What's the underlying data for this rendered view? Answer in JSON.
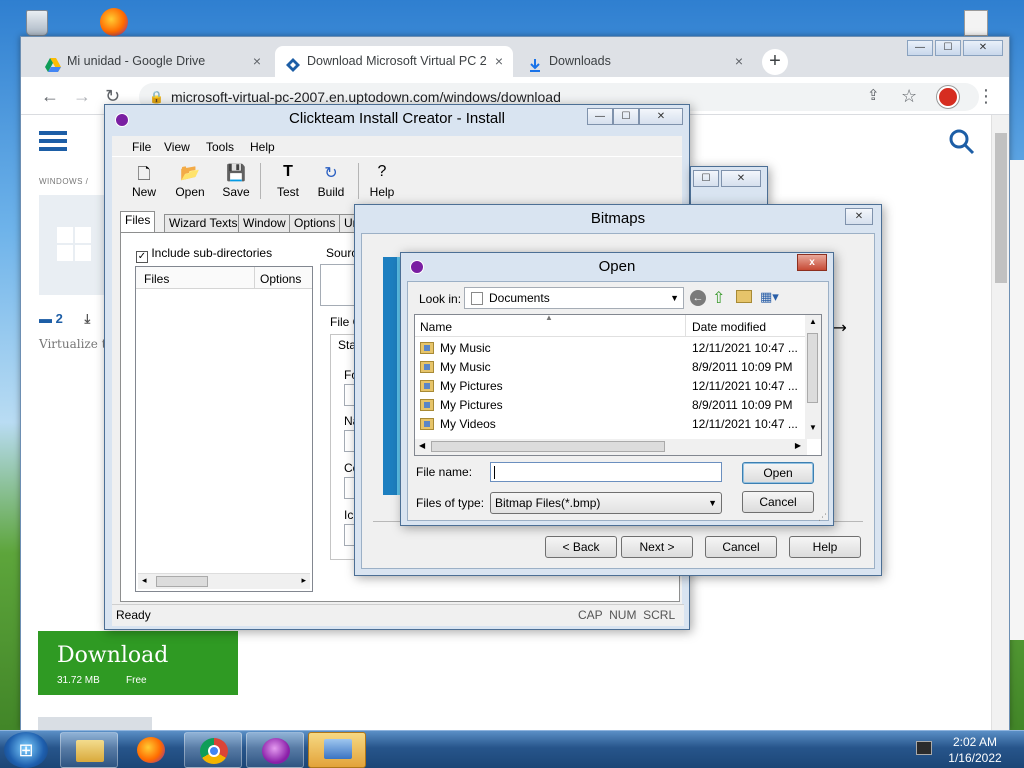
{
  "chrome": {
    "tabs": [
      {
        "label": "Mi unidad - Google Drive",
        "close": "×"
      },
      {
        "label": "Download Microsoft Virtual PC 2",
        "close": "×"
      },
      {
        "label": "Downloads",
        "close": "×"
      }
    ],
    "new_tab": "+",
    "url": "microsoft-virtual-pc-2007.en.uptodown.com/windows/download"
  },
  "page": {
    "breadcrumb": "WINDOWS  /",
    "comments": "2",
    "description": "Virtualize the",
    "download": {
      "label": "Download",
      "size": "31.72 MB",
      "license": "Free"
    }
  },
  "installer": {
    "title": "Clickteam Install Creator - Install",
    "menu": [
      "File",
      "View",
      "Tools",
      "Help"
    ],
    "toolbar": [
      "New",
      "Open",
      "Save",
      "Test",
      "Build",
      "Help"
    ],
    "tabs": [
      "Files",
      "Wizard Texts",
      "Window",
      "Options",
      "Un"
    ],
    "include_subdirs": "Include sub-directories",
    "files_header": "Files",
    "options_header": "Options",
    "source_label": "Sourc",
    "file_group_label": "File C",
    "sta_label": "Sta",
    "fo_label": "Fo",
    "na_label": "Na",
    "co_label": "Co",
    "ic_label": "Ic",
    "status": "Ready",
    "indicators": "CAP  NUM  SCRL"
  },
  "bitmaps": {
    "title": "Bitmaps",
    "close": "✕",
    "back": "< Back",
    "next": "Next >",
    "cancel": "Cancel",
    "help": "Help"
  },
  "open_dialog": {
    "title": "Open",
    "close": "x",
    "look_in_label": "Look in:",
    "look_in_value": "Documents",
    "columns": {
      "name": "Name",
      "date": "Date modified"
    },
    "rows": [
      {
        "name": "My Music",
        "date": "12/11/2021 10:47 ..."
      },
      {
        "name": "My Music",
        "date": "8/9/2011 10:09 PM"
      },
      {
        "name": "My Pictures",
        "date": "12/11/2021 10:47 ..."
      },
      {
        "name": "My Pictures",
        "date": "8/9/2011 10:09 PM"
      },
      {
        "name": "My Videos",
        "date": "12/11/2021 10:47 ..."
      }
    ],
    "file_name_label": "File name:",
    "file_name_value": "",
    "files_of_type_label": "Files of type:",
    "files_of_type_value": "Bitmap Files(*.bmp)",
    "open_button": "Open",
    "cancel_button": "Cancel"
  },
  "taskbar": {
    "time": "2:02 AM",
    "date": "1/16/2022"
  }
}
